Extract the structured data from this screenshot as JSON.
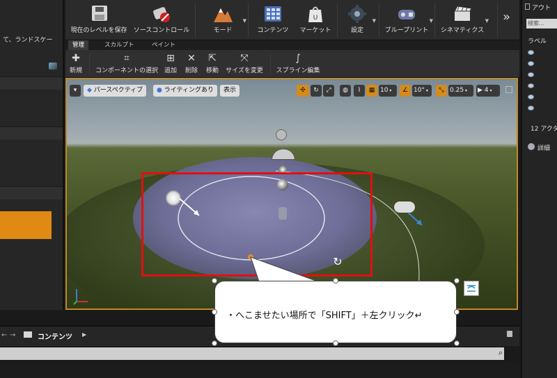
{
  "left_panel": {
    "header_text": "て、ランドスケー"
  },
  "toolbar": {
    "items": [
      {
        "label": "現在のレベルを保存",
        "icon": "save-icon"
      },
      {
        "label": "ソースコントロール",
        "icon": "source-control-icon"
      },
      {
        "label": "モード",
        "icon": "modes-icon"
      },
      {
        "label": "コンテンツ",
        "icon": "content-icon"
      },
      {
        "label": "マーケット",
        "icon": "marketplace-icon"
      },
      {
        "label": "設定",
        "icon": "settings-icon"
      },
      {
        "label": "ブループリント",
        "icon": "blueprint-icon"
      },
      {
        "label": "シネマティクス",
        "icon": "cinematics-icon"
      }
    ],
    "overflow": "»"
  },
  "mode_tabs": [
    {
      "label": "管理",
      "active": true
    },
    {
      "label": "スカルプト",
      "active": false
    },
    {
      "label": "ペイント",
      "active": false
    }
  ],
  "sub_toolbar": [
    {
      "label": "新規"
    },
    {
      "label": "コンポーネントの選択"
    },
    {
      "label": "追加"
    },
    {
      "label": "削除"
    },
    {
      "label": "移動"
    },
    {
      "label": "サイズを変更"
    },
    {
      "label": "スプライン編集"
    }
  ],
  "viewport": {
    "perspective_label": "パースペクティブ",
    "lighting_label": "ライティングあり",
    "show_label": "表示",
    "grid_snap": "10",
    "rotation_snap": "10°",
    "scale_snap": "0.25",
    "camera_speed": "4"
  },
  "content_browser": {
    "tab_label": "コンテンツ"
  },
  "outliner": {
    "title": "アウト",
    "search_placeholder": "検索...",
    "column_label": "ラベル",
    "actor_count": "12 アクタ",
    "details_label": "詳細"
  },
  "callout": {
    "text": "・へこませたい場所で「SHIFT」＋左クリック↵"
  },
  "colors": {
    "accent": "#e08a14",
    "selection": "#e01010"
  }
}
